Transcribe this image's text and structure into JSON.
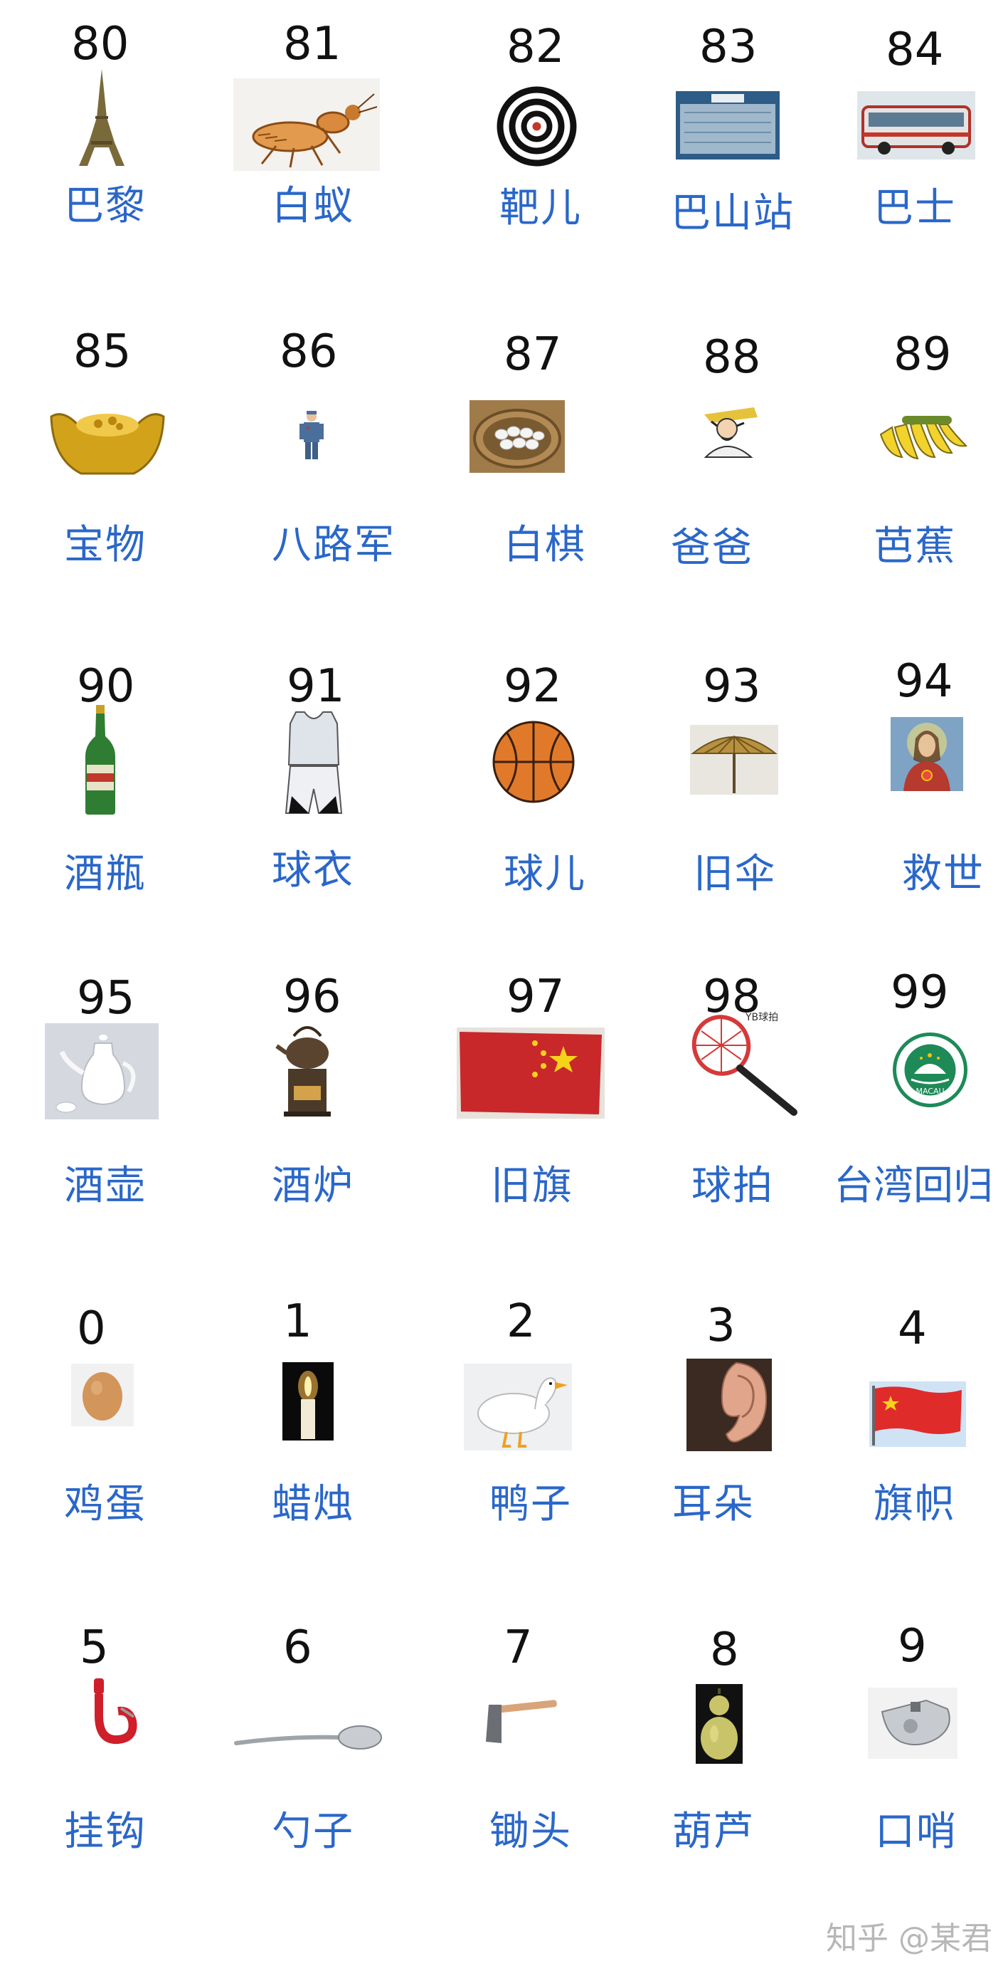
{
  "rows": [
    [
      {
        "num": "80",
        "word": "巴黎",
        "icon": "eiffel-tower-icon"
      },
      {
        "num": "81",
        "word": "白蚁",
        "icon": "termite-icon"
      },
      {
        "num": "82",
        "word": "靶儿",
        "icon": "target-icon"
      },
      {
        "num": "83",
        "word": "巴山站",
        "icon": "station-board-icon"
      },
      {
        "num": "84",
        "word": "巴士",
        "icon": "bus-icon"
      }
    ],
    [
      {
        "num": "85",
        "word": "宝物",
        "icon": "gold-ingot-icon"
      },
      {
        "num": "86",
        "word": "八路军",
        "icon": "soldier-icon"
      },
      {
        "num": "87",
        "word": "白棋",
        "icon": "go-stones-icon"
      },
      {
        "num": "88",
        "word": "爸爸",
        "icon": "father-icon"
      },
      {
        "num": "89",
        "word": "芭蕉",
        "icon": "bananas-icon"
      }
    ],
    [
      {
        "num": "90",
        "word": "酒瓶",
        "icon": "beer-bottle-icon"
      },
      {
        "num": "91",
        "word": "球衣",
        "icon": "jersey-icon"
      },
      {
        "num": "92",
        "word": "球儿",
        "icon": "basketball-icon"
      },
      {
        "num": "93",
        "word": "旧伞",
        "icon": "old-umbrella-icon"
      },
      {
        "num": "94",
        "word": "救世",
        "icon": "savior-portrait-icon"
      }
    ],
    [
      {
        "num": "95",
        "word": "酒壶",
        "icon": "wine-pot-icon"
      },
      {
        "num": "96",
        "word": "酒炉",
        "icon": "wine-stove-icon"
      },
      {
        "num": "97",
        "word": "旧旗",
        "icon": "old-flag-icon"
      },
      {
        "num": "98",
        "word": "球拍",
        "icon": "racket-icon",
        "badge": "YB球拍"
      },
      {
        "num": "99",
        "word": "台湾回归",
        "icon": "emblem-icon",
        "badge": "MACAU"
      }
    ],
    [
      {
        "num": "0",
        "word": "鸡蛋",
        "icon": "egg-icon"
      },
      {
        "num": "1",
        "word": "蜡烛",
        "icon": "candle-icon"
      },
      {
        "num": "2",
        "word": "鸭子",
        "icon": "duck-icon"
      },
      {
        "num": "3",
        "word": "耳朵",
        "icon": "ear-icon"
      },
      {
        "num": "4",
        "word": "旗帜",
        "icon": "flag-icon"
      }
    ],
    [
      {
        "num": "5",
        "word": "挂钩",
        "icon": "hook-icon"
      },
      {
        "num": "6",
        "word": "勺子",
        "icon": "spoon-icon"
      },
      {
        "num": "7",
        "word": "锄头",
        "icon": "hoe-icon"
      },
      {
        "num": "8",
        "word": "葫芦",
        "icon": "gourd-icon"
      },
      {
        "num": "9",
        "word": "口哨",
        "icon": "whistle-icon"
      }
    ]
  ],
  "watermark": "知乎 @某君",
  "colors": {
    "word": "#2a67c9",
    "number": "#111111",
    "watermark": "#b7b7b7"
  }
}
